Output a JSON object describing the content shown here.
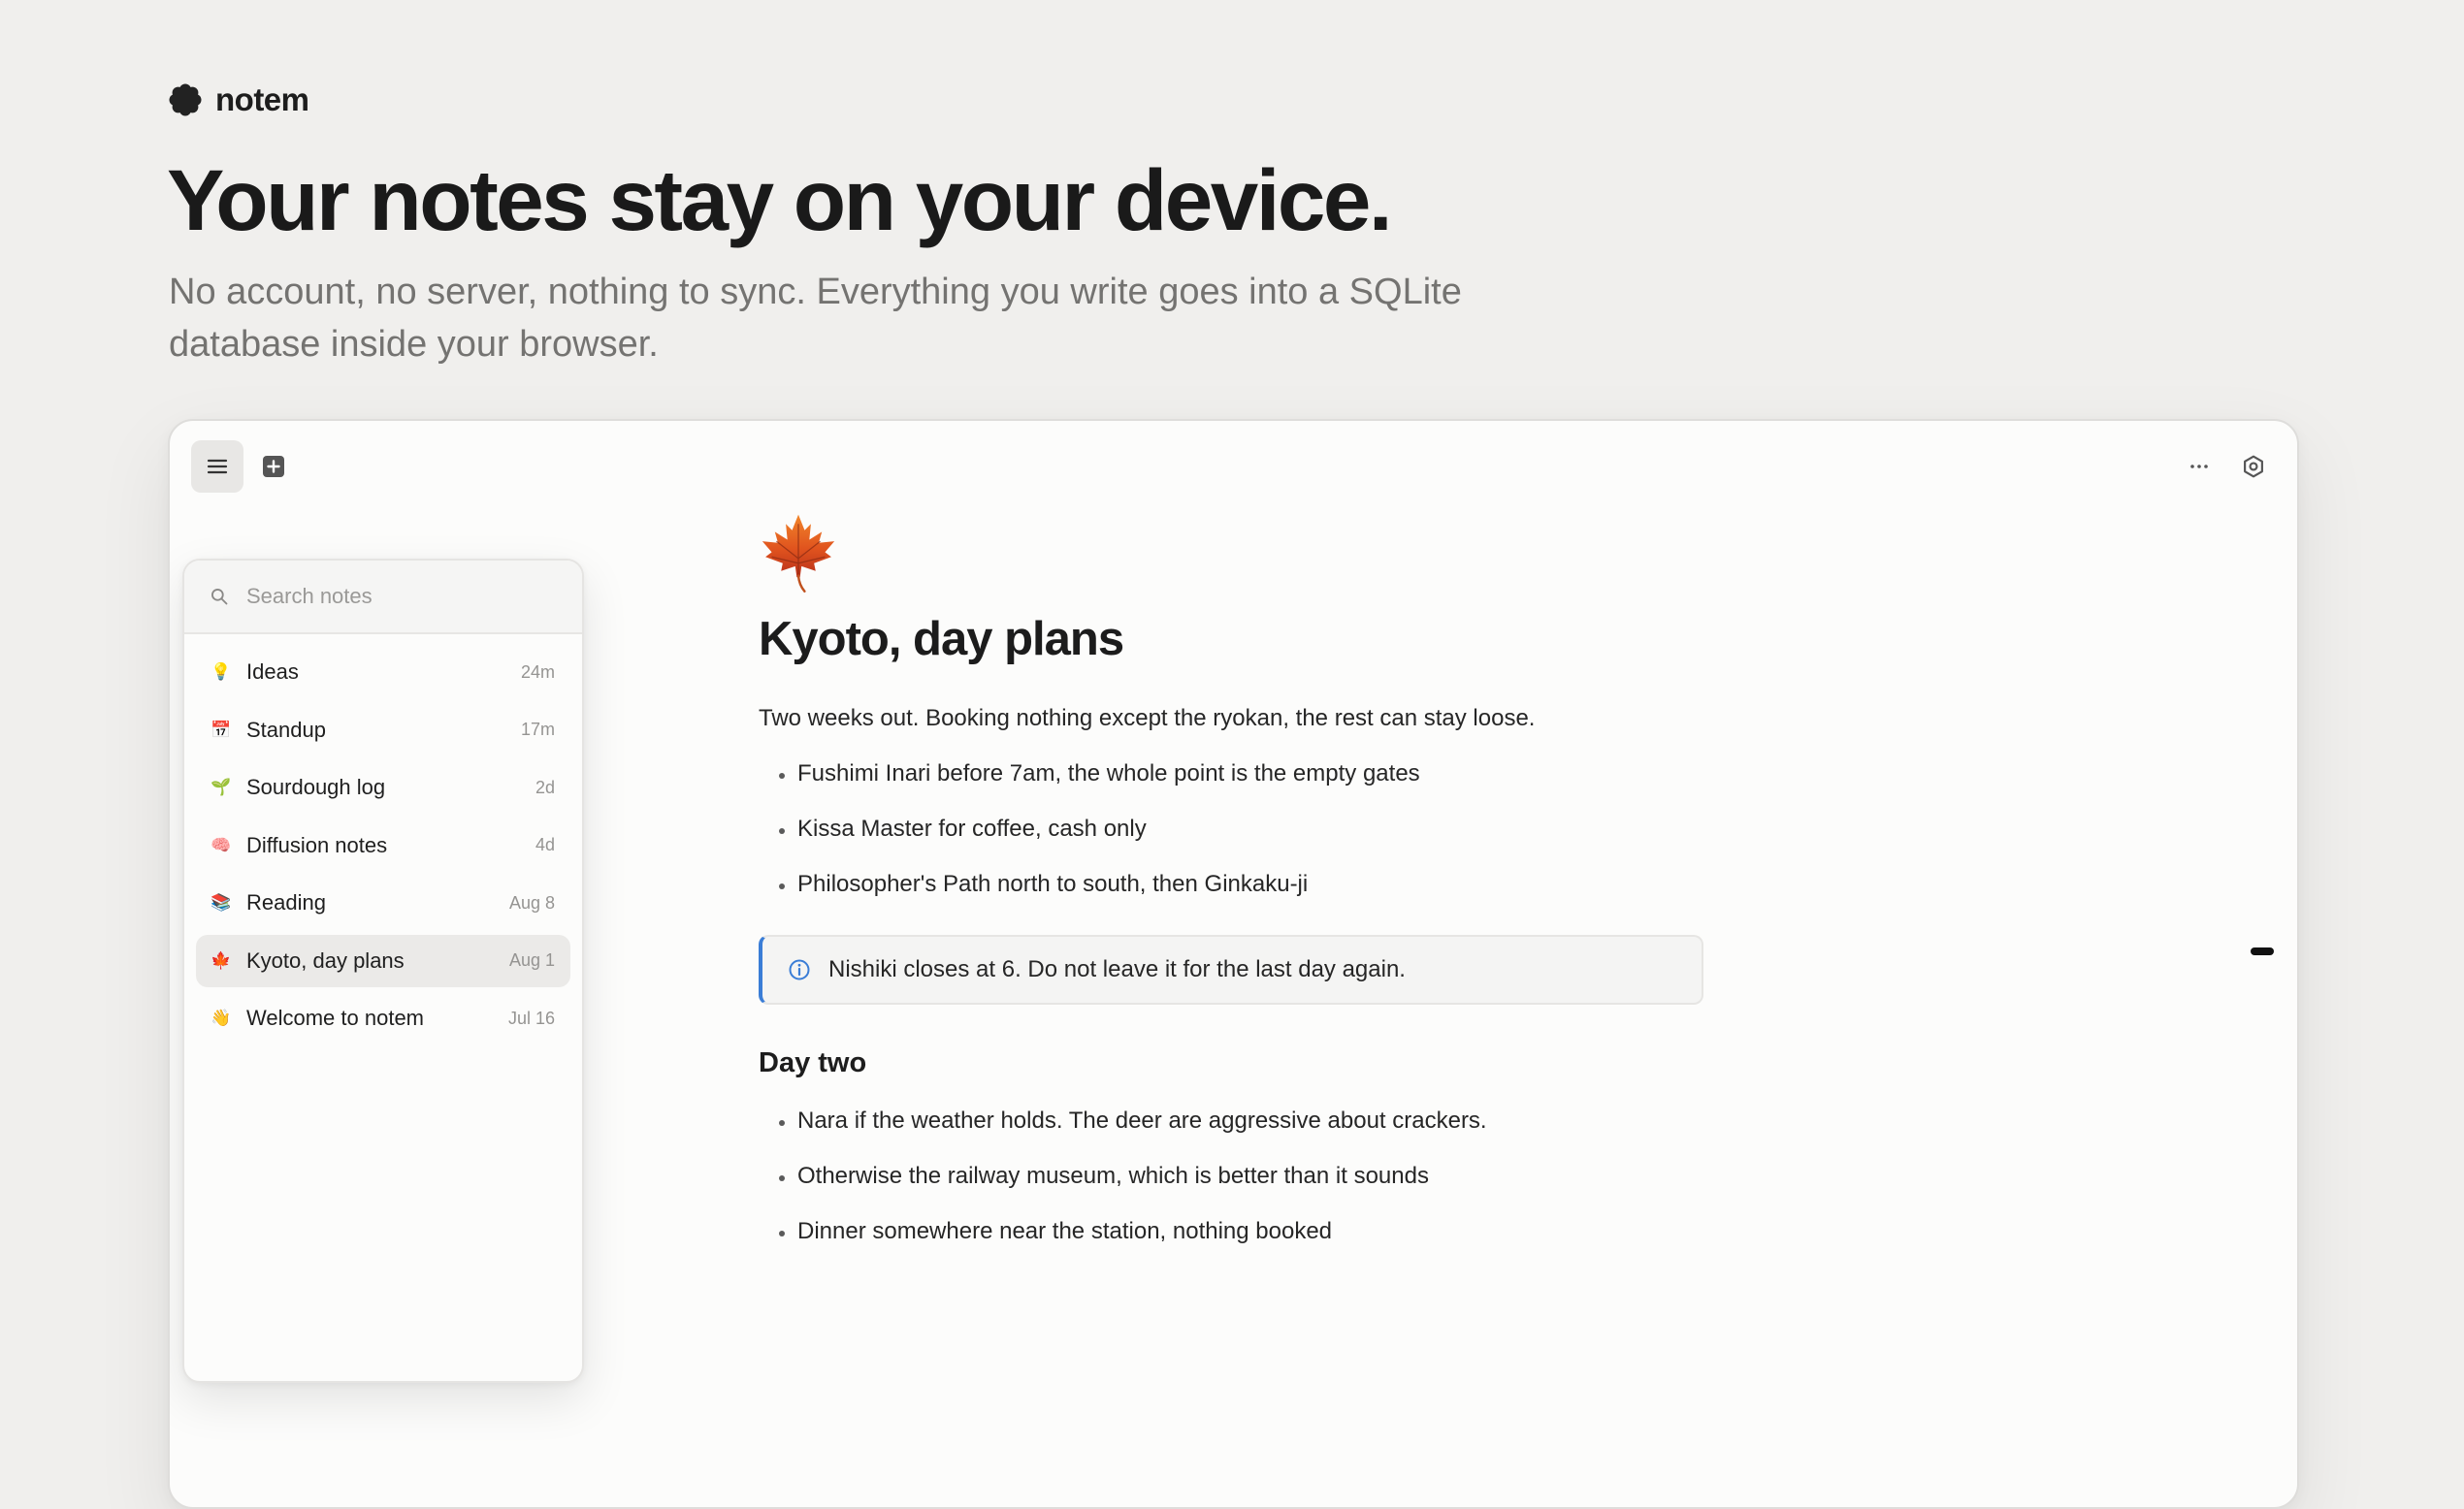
{
  "brand": {
    "name": "notem",
    "logo_icon": "flower-logo-icon"
  },
  "hero": {
    "title": "Your notes stay on your device.",
    "subtitle": "No account, no server, nothing to sync. Everything you write goes into a SQLite database inside your browser."
  },
  "toolbar": {
    "menu_icon": "menu-icon",
    "new_note_icon": "plus-square-icon",
    "more_icon": "more-horizontal-icon",
    "settings_icon": "gear-icon"
  },
  "sidebar": {
    "search_placeholder": "Search notes",
    "notes": [
      {
        "emoji": "💡",
        "title": "Ideas",
        "time": "24m",
        "active": false
      },
      {
        "emoji": "📅",
        "title": "Standup",
        "time": "17m",
        "active": false
      },
      {
        "emoji": "🌱",
        "title": "Sourdough log",
        "time": "2d",
        "active": false
      },
      {
        "emoji": "🧠",
        "title": "Diffusion notes",
        "time": "4d",
        "active": false
      },
      {
        "emoji": "📚",
        "title": "Reading",
        "time": "Aug 8",
        "active": false
      },
      {
        "emoji": "🍁",
        "title": "Kyoto, day plans",
        "time": "Aug 1",
        "active": true
      },
      {
        "emoji": "👋",
        "title": "Welcome to notem",
        "time": "Jul 16",
        "active": false
      }
    ]
  },
  "document": {
    "icon": "maple-leaf-icon",
    "title": "Kyoto, day plans",
    "intro": "Two weeks out. Booking nothing except the ryokan, the rest can stay loose.",
    "bullets_1": [
      "Fushimi Inari before 7am, the whole point is the empty gates",
      "Kissa Master for coffee, cash only",
      "Philosopher's Path north to south, then Ginkaku-ji"
    ],
    "callout": "Nishiki closes at 6. Do not leave it for the last day again.",
    "heading_2": "Day two",
    "bullets_2": [
      "Nara if the weather holds. The deer are aggressive about crackers.",
      "Otherwise the railway museum, which is better than it sounds",
      "Dinner somewhere near the station, nothing booked"
    ]
  },
  "colors": {
    "page_bg": "#f0efed",
    "window_bg": "#fcfcfb",
    "callout_accent": "#3a7dd6",
    "muted_text": "#747371"
  }
}
